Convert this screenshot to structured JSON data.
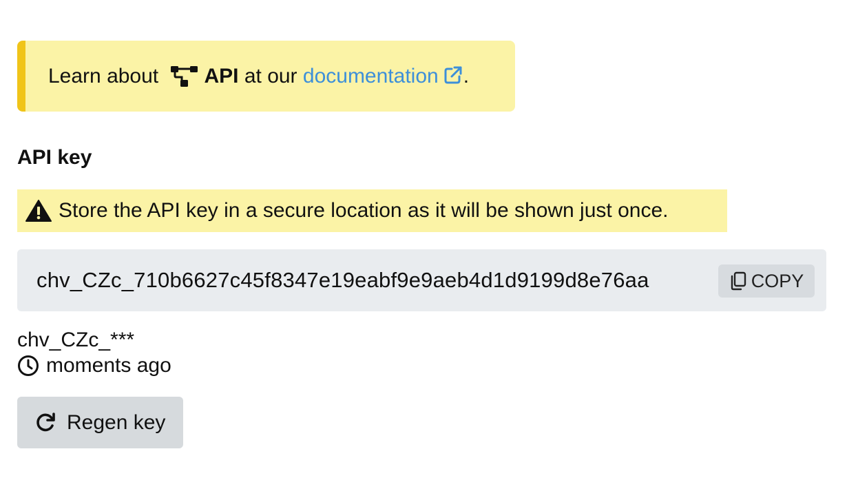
{
  "info_callout": {
    "prefix": "Learn about ",
    "api_label": "API",
    "middle": " at our ",
    "link_label": "documentation",
    "suffix": "."
  },
  "api_key_section": {
    "title": "API key",
    "warning": "Store the API key in a secure location as it will be shown just once.",
    "key_value": "chv_CZc_710b6627c45f8347e19eabf9e9aeb4d1d9199d8e76aa",
    "copy_label": "COPY",
    "key_prefix": "chv_CZc_***",
    "created": "moments ago",
    "regen_label": "Regen key"
  },
  "icons": {
    "api": "api-network-icon",
    "external_link": "external-link-icon",
    "warning": "warning-triangle-icon",
    "copy": "copy-icon",
    "clock": "clock-icon",
    "regen": "redo-icon"
  },
  "colors": {
    "callout_background": "#fbf3a6",
    "callout_border": "#f0c419",
    "link": "#3d8fd9",
    "key_box_background": "#e9ecef",
    "button_background": "#d6dadd"
  }
}
